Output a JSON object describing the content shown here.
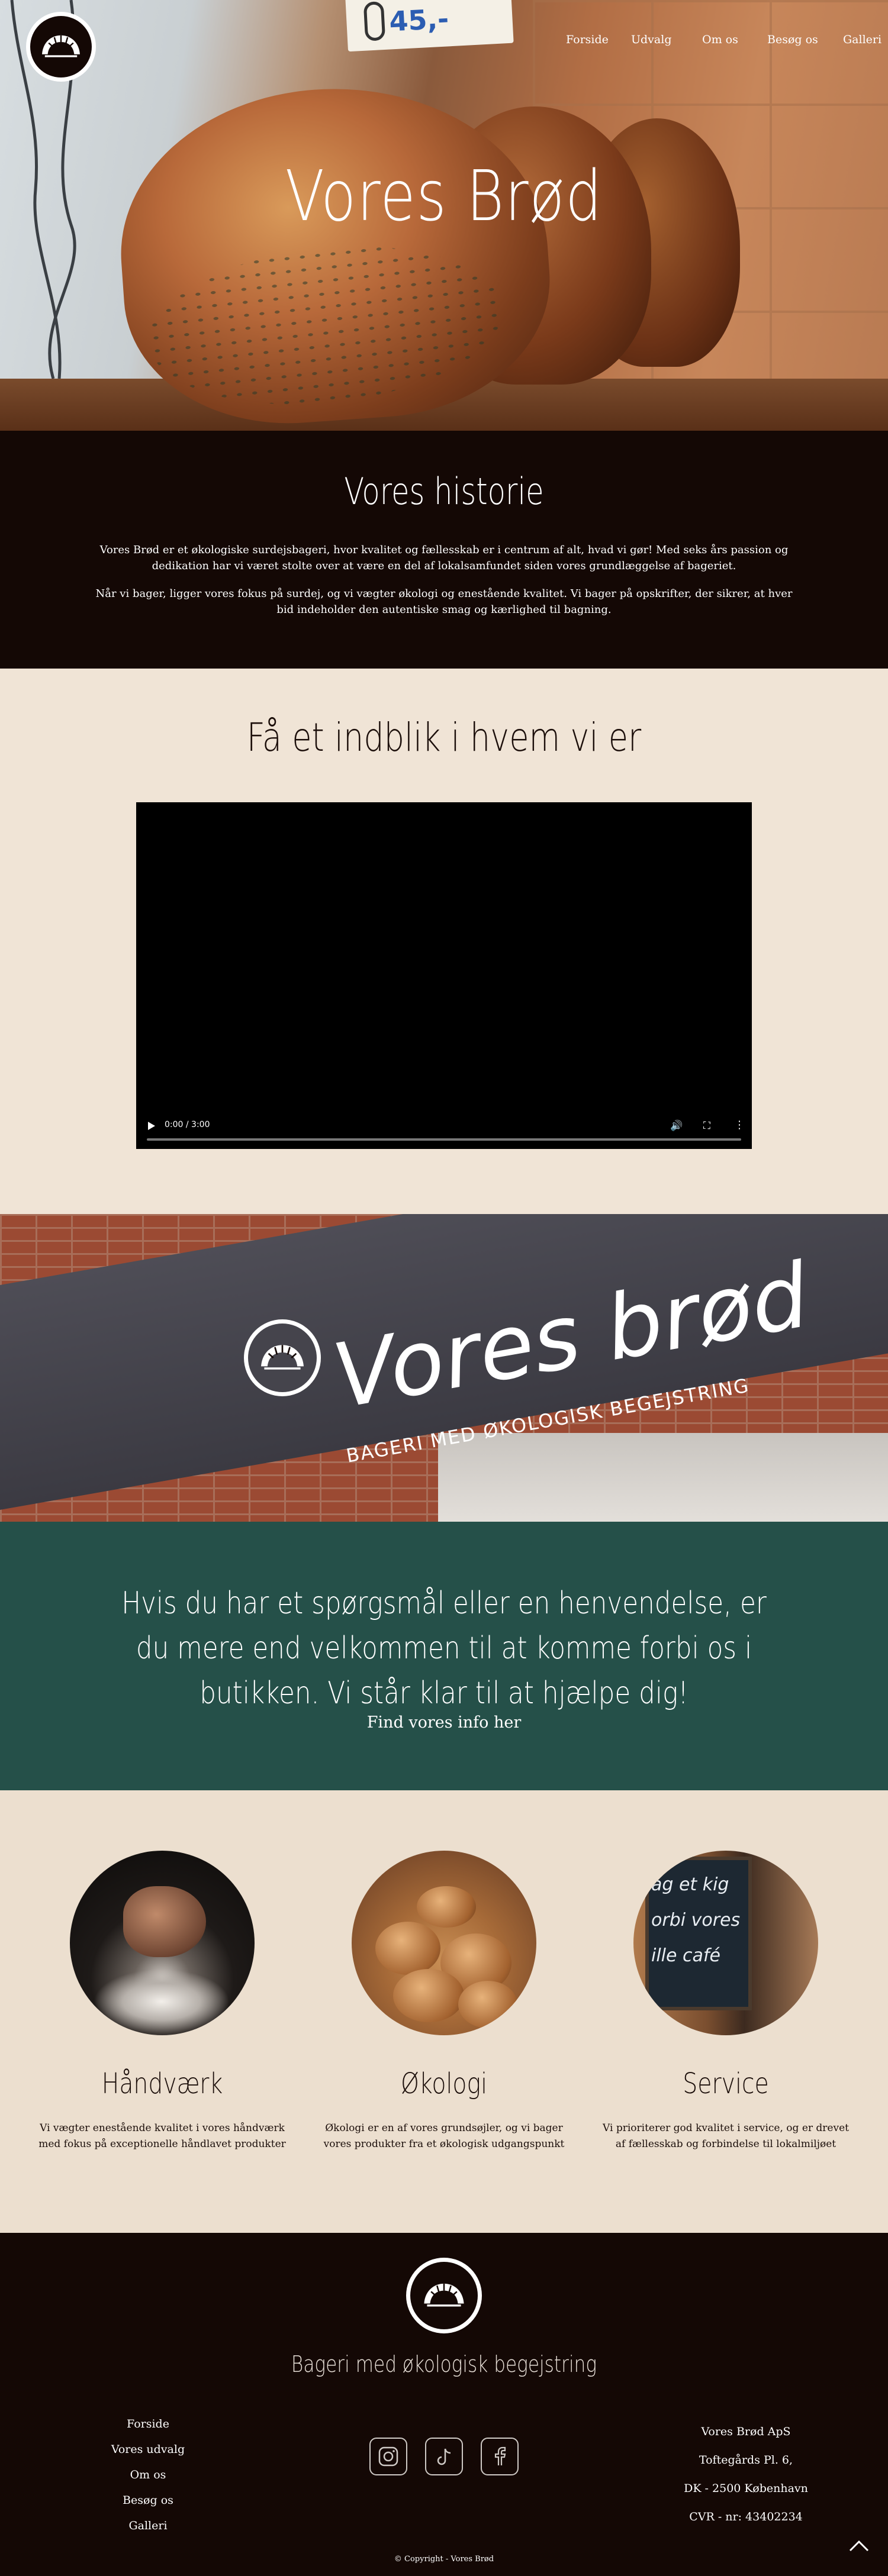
{
  "header": {
    "nav": [
      "Forside",
      "Udvalg",
      "Om os",
      "Besøg os",
      "Galleri"
    ],
    "price_tag": "45,-"
  },
  "hero": {
    "title": "Vores Brød"
  },
  "history": {
    "title": "Vores historie",
    "p1": "Vores Brød er et økologiske surdejsbageri, hvor kvalitet og fællesskab er i centrum af alt, hvad vi gør! Med seks års passion og dedikation har vi været stolte over at være en del af lokalsamfundet siden vores grundlæggelse af bageriet.",
    "p2": "Når vi bager, ligger vores fokus på surdej, og vi vægter økologi og enestående kvalitet. Vi bager på opskrifter, der sikrer, at hver bid indeholder den autentiske smag og kærlighed til bagning."
  },
  "video_section": {
    "title": "Få et indblik i hvem vi er",
    "time": "0:00 / 3:00"
  },
  "storefront": {
    "sign_title": "Vores brød",
    "sign_subtitle": "BAGERI MED ØKOLOGISK BEGEJSTRING"
  },
  "contact": {
    "text": "Hvis du har et spørgsmål eller en henvendelse, er du mere end velkommen til at komme forbi os i butikken. Vi står klar til at hjælpe dig!",
    "link": "Find vores info her"
  },
  "features": [
    {
      "title": "Håndværk",
      "text": "Vi vægter enestående kvalitet i vores håndværk med fokus på exceptionelle håndlavet produkter"
    },
    {
      "title": "Økologi",
      "text": "Økologi er en af vores grundsøjler, og vi bager vores produkter fra et økologisk udgangspunkt"
    },
    {
      "title": "Service",
      "text": "Vi prioriterer god kvalitet i service, og er drevet af fællesskab og forbindelse til lokalmiljøet"
    }
  ],
  "service_chalkboard": [
    "ag et kig",
    "orbi vores",
    "ille café"
  ],
  "footer": {
    "tagline": "Bageri med økologisk begejstring",
    "links": [
      "Forside",
      "Vores udvalg",
      "Om os",
      "Besøg os",
      "Galleri"
    ],
    "social_icons": [
      "instagram-icon",
      "tiktok-icon",
      "facebook-icon"
    ],
    "address": [
      "Vores Brød ApS",
      "Toftegårds Pl. 6,",
      "DK - 2500 København",
      "CVR - nr: 43402234"
    ],
    "copyright": "© Copyright - Vores Brød"
  },
  "colors": {
    "dark": "#140805",
    "cream": "#f0e4d6",
    "green": "#255049"
  }
}
